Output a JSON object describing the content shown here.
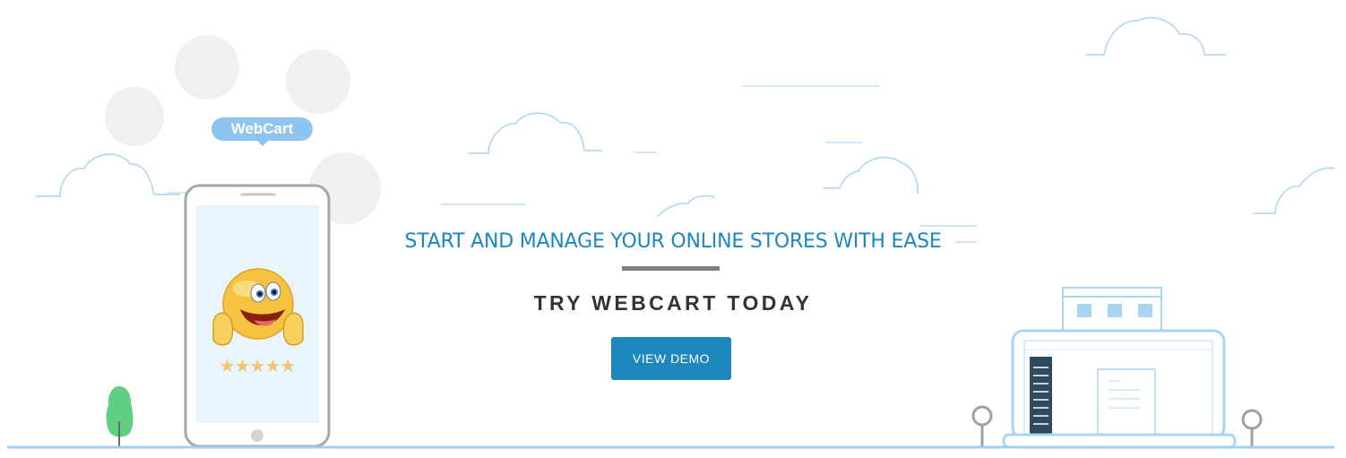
{
  "hero": {
    "headline": "START AND MANAGE YOUR ONLINE STORES WITH EASE",
    "subheadline": "TRY WEBCART TODAY",
    "cta_label": "VIEW DEMO"
  },
  "illustration": {
    "bubble_text": "WebCart",
    "rating_stars": "★★★★★",
    "rating_value": 5,
    "icons": [
      "cloud-icon",
      "phone-icon",
      "smiley-thumbs-up-icon",
      "star-icon",
      "tree-icon",
      "laptop-icon",
      "lamp-post-icon"
    ]
  },
  "colors": {
    "accent": "#1d86bd",
    "headline": "#1d86bd",
    "subheadline": "#333333",
    "divider": "#7f7f7f",
    "line_art": "#9fd0ef",
    "bubble": "#8ec4ee",
    "tree": "#5fcf83",
    "stars": "#f2c46d"
  }
}
